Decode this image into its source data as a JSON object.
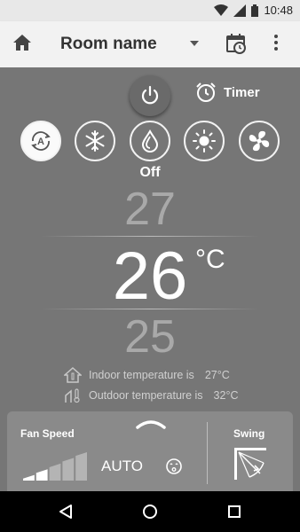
{
  "status_bar": {
    "time": "10:48",
    "icons": [
      "wifi-icon",
      "cellular-signal-icon",
      "battery-icon"
    ]
  },
  "app_bar": {
    "room_name": "Room name",
    "icons": [
      "home-icon",
      "dropdown-arrow-icon",
      "schedule-calendar-icon",
      "more-vert-icon"
    ]
  },
  "controls": {
    "timer_label": "Timer",
    "modes": [
      {
        "name": "auto",
        "icon": "auto-mode-icon",
        "selected": true
      },
      {
        "name": "cool",
        "icon": "snowflake-icon",
        "selected": false
      },
      {
        "name": "dry",
        "icon": "water-drop-icon",
        "selected": false
      },
      {
        "name": "heat",
        "icon": "sun-icon",
        "selected": false
      },
      {
        "name": "fan",
        "icon": "fan-icon",
        "selected": false
      }
    ],
    "mode_state": "Off"
  },
  "temperature": {
    "next_up": "27",
    "current": "26",
    "unit": "°C",
    "next_down": "25"
  },
  "ambient": {
    "indoor_label": "Indoor temperature is",
    "indoor_value": "27°C",
    "outdoor_label": "Outdoor temperature is",
    "outdoor_value": "32°C"
  },
  "bottom_panel": {
    "fan_speed_label": "Fan Speed",
    "fan_speed_value": "AUTO",
    "fan_speed_level": 2,
    "fan_speed_levels": 5,
    "swing_label": "Swing"
  },
  "colors": {
    "background": "#767676",
    "app_bar": "#f2f2f2",
    "panel": "#8a8a8a",
    "accent": "#ffffff"
  }
}
